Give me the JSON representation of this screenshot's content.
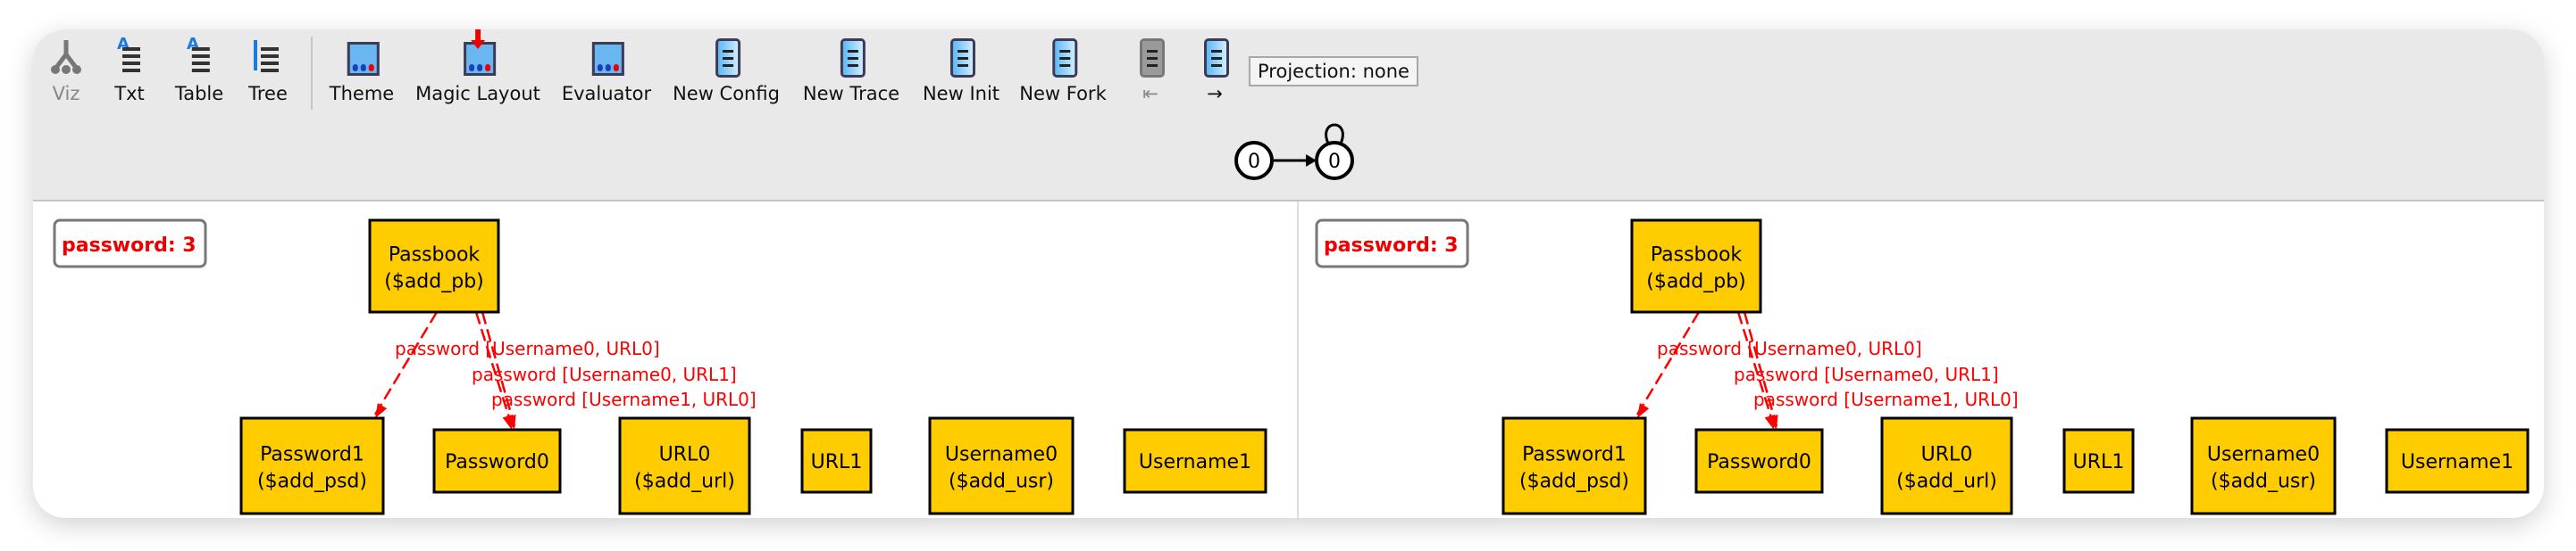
{
  "toolbar": {
    "items": [
      {
        "label": "Viz",
        "icon": "viz-icon",
        "disabled": true
      },
      {
        "label": "Txt",
        "icon": "txt-icon"
      },
      {
        "label": "Table",
        "icon": "table-icon"
      },
      {
        "label": "Tree",
        "icon": "tree-icon"
      },
      {
        "label": "Theme",
        "icon": "theme-icon"
      },
      {
        "label": "Magic Layout",
        "icon": "magic-layout-icon"
      },
      {
        "label": "Evaluator",
        "icon": "evaluator-icon"
      },
      {
        "label": "New Config",
        "icon": "scroll-icon"
      },
      {
        "label": "New Trace",
        "icon": "scroll-icon"
      },
      {
        "label": "New Init",
        "icon": "scroll-icon"
      },
      {
        "label": "New Fork",
        "icon": "scroll-icon"
      },
      {
        "label": "⇤",
        "icon": "scroll-icon",
        "disabled": true
      },
      {
        "label": "→",
        "icon": "scroll-icon"
      }
    ],
    "projection": "Projection: none"
  },
  "trace_graph": {
    "states": [
      "0",
      "0"
    ]
  },
  "colors": {
    "node_fill": "#ffcc00",
    "edge": "#ff0000",
    "toolbar_bg": "#e9e9e9"
  },
  "panels": [
    {
      "skolem": "password: 3",
      "nodes": [
        {
          "line1": "Passbook",
          "line2": "($add_pb)"
        },
        {
          "line1": "Password1",
          "line2": "($add_psd)"
        },
        {
          "line1": "Password0",
          "line2": ""
        },
        {
          "line1": "URL0",
          "line2": "($add_url)"
        },
        {
          "line1": "URL1",
          "line2": ""
        },
        {
          "line1": "Username0",
          "line2": "($add_usr)"
        },
        {
          "line1": "Username1",
          "line2": ""
        }
      ],
      "edges": [
        {
          "from": "Passbook",
          "to": "Password1",
          "label": "password [Username0, URL0]"
        },
        {
          "from": "Passbook",
          "to": "Password0",
          "label": "password [Username0, URL1]"
        },
        {
          "from": "Passbook",
          "to": "Password0",
          "label": "password [Username1, URL0]"
        }
      ]
    },
    {
      "skolem": "password: 3",
      "nodes": [
        {
          "line1": "Passbook",
          "line2": "($add_pb)"
        },
        {
          "line1": "Password1",
          "line2": "($add_psd)"
        },
        {
          "line1": "Password0",
          "line2": ""
        },
        {
          "line1": "URL0",
          "line2": "($add_url)"
        },
        {
          "line1": "URL1",
          "line2": ""
        },
        {
          "line1": "Username0",
          "line2": "($add_usr)"
        },
        {
          "line1": "Username1",
          "line2": ""
        }
      ],
      "edges": [
        {
          "from": "Passbook",
          "to": "Password1",
          "label": "password [Username0, URL0]"
        },
        {
          "from": "Passbook",
          "to": "Password0",
          "label": "password [Username0, URL1]"
        },
        {
          "from": "Passbook",
          "to": "Password0",
          "label": "password [Username1, URL0]"
        }
      ]
    }
  ]
}
